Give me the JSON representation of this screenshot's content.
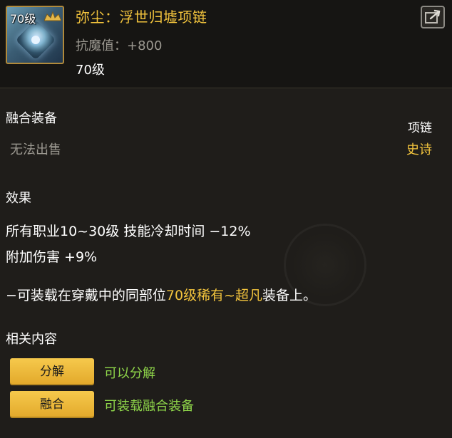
{
  "item": {
    "level_badge": "70级",
    "title": "弥尘：浮世归墟项链",
    "stat": "抗魔值：+800",
    "level": "70级"
  },
  "equipment": {
    "section_label": "融合装备",
    "sale_status": "无法出售",
    "slot_type": "项链",
    "rarity": "史诗"
  },
  "effect": {
    "section_label": "效果",
    "lines": [
      "所有职业10~30级 技能冷却时间 −12%",
      "附加伤害 +9%"
    ],
    "note_prefix": "−可装载在穿戴中的同部位",
    "note_highlight": "70级稀有~超凡",
    "note_suffix": "装备上。"
  },
  "related": {
    "section_label": "相关内容",
    "buttons": [
      {
        "label": "分解",
        "description": "可以分解"
      },
      {
        "label": "融合",
        "description": "可装载融合装备"
      }
    ]
  },
  "colors": {
    "gold": "#f3c43d",
    "green": "#8fd64a",
    "muted": "#9b9890",
    "button": "#f0bd3e"
  },
  "icons": {
    "item": "epic-necklace-icon",
    "crown": "crown-icon",
    "share": "share-icon"
  }
}
